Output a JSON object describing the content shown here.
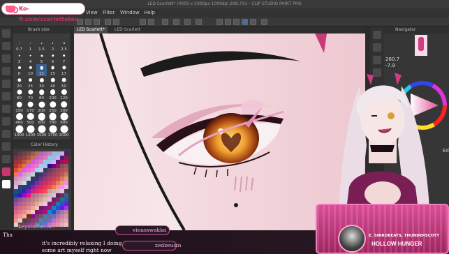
{
  "kofi": {
    "text": "Ko-fi.com/scarlettetea"
  },
  "titlebar": {
    "text": "LED Scarlett* (4000 x 5000px 1000dpi 299.7%) - CLIP STUDIO PAINT PRO"
  },
  "menu": {
    "items": [
      "View",
      "Filter",
      "Window",
      "Help"
    ]
  },
  "brush_panel": {
    "title": "Brush size",
    "sizes": [
      "0.7",
      "1",
      "1.5",
      "2",
      "2.5",
      "3",
      "4",
      "5",
      "6",
      "7",
      "8",
      "10",
      "12",
      "15",
      "17",
      "20",
      "25",
      "30",
      "40",
      "50",
      "60",
      "70",
      "80",
      "100",
      "120",
      "150",
      "170",
      "200",
      "250",
      "300",
      "400",
      "500",
      "600",
      "700",
      "800",
      "1000",
      "1200",
      "1500",
      "1700",
      "2000"
    ],
    "selected": "12"
  },
  "color_history": {
    "title": "Color History"
  },
  "canvas_tabs": [
    "LED Scarlett*",
    "LED Scarlett"
  ],
  "navigator": {
    "title": "Navigator",
    "zoom": "260.7",
    "rotation": "-7.9"
  },
  "edit_label": "Edi",
  "chat": {
    "messages": [
      {
        "user": "keystothecar:",
        "text": "Thx"
      },
      {
        "user": "",
        "text": "it's incredibly relaxing I doing some art myself right now"
      }
    ],
    "pills": [
      "vinasswakka",
      "zedzeusin"
    ]
  },
  "alert": {
    "subscribers": "E. SHIROBEATS, THUNDERSCOTT",
    "title": "HOLLOW HUNGER"
  },
  "colors": {
    "accent": "#e0559a",
    "panel": "#3b3b3b",
    "canvas_skin": "#f4dde2"
  }
}
